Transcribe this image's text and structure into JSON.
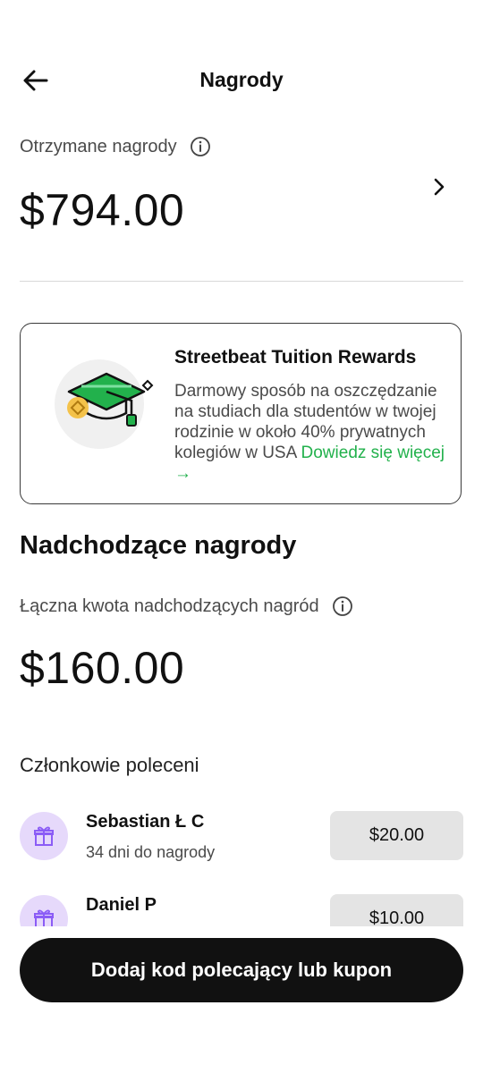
{
  "header": {
    "title": "Nagrody",
    "back_icon": "arrow-left-icon"
  },
  "received": {
    "label": "Otrzymane nagrody",
    "amount": "$794.00",
    "info_icon": "info-icon",
    "chevron_icon": "chevron-right-icon"
  },
  "promo": {
    "title": "Streetbeat Tuition Rewards",
    "description": "Darmowy sposób na oszczędzanie na studiach dla studentów w twojej rodzinie w około 40% prywatnych kolegiów w USA",
    "link": "Dowiedz się więcej →",
    "icon": "graduation-cap-icon",
    "accent_color": "#22b14c"
  },
  "upcoming": {
    "title": "Nadchodzące nagrody",
    "total_label": "Łączna kwota nadchodzących nagród",
    "total_amount": "$160.00",
    "members_title": "Członkowie poleceni",
    "members": [
      {
        "name": "Sebastian Ł C",
        "days": "34 dni do nagrody",
        "reward": "$20.00",
        "icon": "gift-icon"
      },
      {
        "name": "Daniel P",
        "days": "",
        "reward": "$10.00",
        "icon": "gift-icon"
      }
    ]
  },
  "cta": {
    "label": "Dodaj kod polecający lub kupon"
  }
}
